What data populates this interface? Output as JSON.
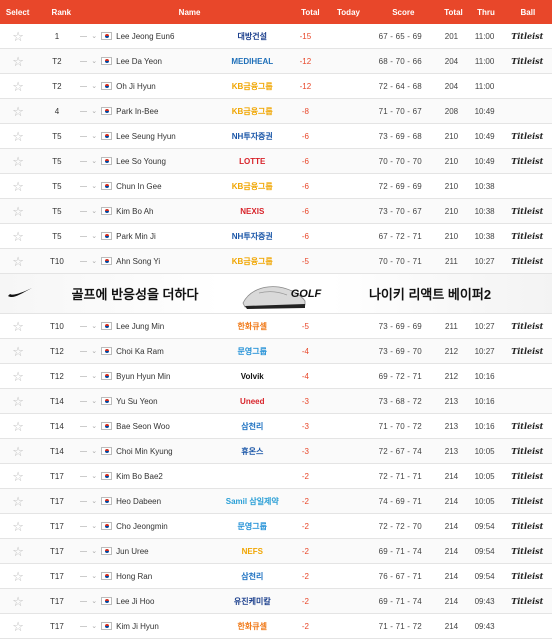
{
  "header": {
    "select": "Select",
    "rank": "Rank",
    "name": "Name",
    "total": "Total",
    "today": "Today",
    "score": "Score",
    "total2": "Total",
    "thru": "Thru",
    "ball": "Ball"
  },
  "colors": {
    "accent": "#e8472a",
    "header_text": "#ffffff"
  },
  "rows_top": [
    {
      "rank": "1",
      "move": "—",
      "name": "Lee Jeong Eun6",
      "sponsor": "대방건설",
      "sponsor_color": "#1a3e8c",
      "total": "-15",
      "score": "67 - 65 - 69",
      "total2": "201",
      "thru": "11:00",
      "ball": "Titleist"
    },
    {
      "rank": "T2",
      "move": "—",
      "name": "Lee Da Yeon",
      "sponsor": "MEDIHEAL",
      "sponsor_color": "#1f6fb8",
      "total": "-12",
      "score": "68 - 70 - 66",
      "total2": "204",
      "thru": "11:00",
      "ball": "Titleist"
    },
    {
      "rank": "T2",
      "move": "—",
      "name": "Oh Ji Hyun",
      "sponsor": "KB금융그룹",
      "sponsor_color": "#f0a500",
      "total": "-12",
      "score": "72 - 64 - 68",
      "total2": "204",
      "thru": "11:00",
      "ball": ""
    },
    {
      "rank": "4",
      "move": "—",
      "name": "Park In-Bee",
      "sponsor": "KB금융그룹",
      "sponsor_color": "#f0a500",
      "total": "-8",
      "score": "71 - 70 - 67",
      "total2": "208",
      "thru": "10:49",
      "ball": ""
    },
    {
      "rank": "T5",
      "move": "—",
      "name": "Lee Seung Hyun",
      "sponsor": "NH투자증권",
      "sponsor_color": "#1a56a8",
      "total": "-6",
      "score": "73 - 69 - 68",
      "total2": "210",
      "thru": "10:49",
      "ball": "Titleist"
    },
    {
      "rank": "T5",
      "move": "—",
      "name": "Lee So Young",
      "sponsor": "LOTTE",
      "sponsor_color": "#d8232a",
      "total": "-6",
      "score": "70 - 70 - 70",
      "total2": "210",
      "thru": "10:49",
      "ball": "Titleist"
    },
    {
      "rank": "T5",
      "move": "—",
      "name": "Chun In Gee",
      "sponsor": "KB금융그룹",
      "sponsor_color": "#f0a500",
      "total": "-6",
      "score": "72 - 69 - 69",
      "total2": "210",
      "thru": "10:38",
      "ball": ""
    },
    {
      "rank": "T5",
      "move": "—",
      "name": "Kim Bo Ah",
      "sponsor": "NEXIS",
      "sponsor_color": "#d8232a",
      "total": "-6",
      "score": "73 - 70 - 67",
      "total2": "210",
      "thru": "10:38",
      "ball": "Titleist"
    },
    {
      "rank": "T5",
      "move": "—",
      "name": "Park Min Ji",
      "sponsor": "NH투자증권",
      "sponsor_color": "#1a56a8",
      "total": "-6",
      "score": "67 - 72 - 71",
      "total2": "210",
      "thru": "10:38",
      "ball": "Titleist"
    },
    {
      "rank": "T10",
      "move": "—",
      "name": "Ahn Song Yi",
      "sponsor": "KB금융그룹",
      "sponsor_color": "#f0a500",
      "total": "-5",
      "score": "70 - 70 - 71",
      "total2": "211",
      "thru": "10:27",
      "ball": "Titleist"
    }
  ],
  "ad": {
    "left_text": "골프에 반응성을 더하다",
    "golf_text": "GOLF",
    "right_text": "나이키 리액트 베이퍼2"
  },
  "rows_bottom": [
    {
      "rank": "T10",
      "move": "—",
      "name": "Lee Jung Min",
      "sponsor": "한화큐셀",
      "sponsor_color": "#f07a1a",
      "total": "-5",
      "score": "73 - 69 - 69",
      "total2": "211",
      "thru": "10:27",
      "ball": "Titleist"
    },
    {
      "rank": "T12",
      "move": "—",
      "name": "Choi Ka Ram",
      "sponsor": "문영그룹",
      "sponsor_color": "#1f8fd6",
      "total": "-4",
      "score": "73 - 69 - 70",
      "total2": "212",
      "thru": "10:27",
      "ball": "Titleist"
    },
    {
      "rank": "T12",
      "move": "—",
      "name": "Byun Hyun Min",
      "sponsor": "Volvik",
      "sponsor_color": "#111111",
      "total": "-4",
      "score": "69 - 72 - 71",
      "total2": "212",
      "thru": "10:16",
      "ball": ""
    },
    {
      "rank": "T14",
      "move": "—",
      "name": "Yu Su Yeon",
      "sponsor": "Uneed",
      "sponsor_color": "#d8232a",
      "total": "-3",
      "score": "73 - 68 - 72",
      "total2": "213",
      "thru": "10:16",
      "ball": ""
    },
    {
      "rank": "T14",
      "move": "—",
      "name": "Bae Seon Woo",
      "sponsor": "삼천리",
      "sponsor_color": "#1a6fc0",
      "total": "-3",
      "score": "71 - 70 - 72",
      "total2": "213",
      "thru": "10:16",
      "ball": "Titleist"
    },
    {
      "rank": "T14",
      "move": "—",
      "name": "Choi Min Kyung",
      "sponsor": "휴온스",
      "sponsor_color": "#1a56a8",
      "total": "-3",
      "score": "72 - 67 - 74",
      "total2": "213",
      "thru": "10:05",
      "ball": "Titleist"
    },
    {
      "rank": "T17",
      "move": "—",
      "name": "Kim Bo Bae2",
      "sponsor": "",
      "sponsor_color": "#333333",
      "total": "-2",
      "score": "72 - 71 - 71",
      "total2": "214",
      "thru": "10:05",
      "ball": "Titleist"
    },
    {
      "rank": "T17",
      "move": "—",
      "name": "Heo Dabeen",
      "sponsor": "Samil 삼일제약",
      "sponsor_color": "#2a9fd6",
      "total": "-2",
      "score": "74 - 69 - 71",
      "total2": "214",
      "thru": "10:05",
      "ball": "Titleist"
    },
    {
      "rank": "T17",
      "move": "—",
      "name": "Cho Jeongmin",
      "sponsor": "문영그룹",
      "sponsor_color": "#1f8fd6",
      "total": "-2",
      "score": "72 - 72 - 70",
      "total2": "214",
      "thru": "09:54",
      "ball": "Titleist"
    },
    {
      "rank": "T17",
      "move": "—",
      "name": "Jun Uree",
      "sponsor": "NEFS",
      "sponsor_color": "#f0a500",
      "total": "-2",
      "score": "69 - 71 - 74",
      "total2": "214",
      "thru": "09:54",
      "ball": "Titleist"
    },
    {
      "rank": "T17",
      "move": "—",
      "name": "Hong Ran",
      "sponsor": "삼천리",
      "sponsor_color": "#1a6fc0",
      "total": "-2",
      "score": "76 - 67 - 71",
      "total2": "214",
      "thru": "09:54",
      "ball": "Titleist"
    },
    {
      "rank": "T17",
      "move": "—",
      "name": "Lee Ji Hoo",
      "sponsor": "유진케미칼",
      "sponsor_color": "#1a3e8c",
      "total": "-2",
      "score": "69 - 71 - 74",
      "total2": "214",
      "thru": "09:43",
      "ball": "Titleist"
    },
    {
      "rank": "T17",
      "move": "—",
      "name": "Kim Ji Hyun",
      "sponsor": "한화큐셀",
      "sponsor_color": "#f07a1a",
      "total": "-2",
      "score": "71 - 71 - 72",
      "total2": "214",
      "thru": "09:43",
      "ball": ""
    }
  ]
}
